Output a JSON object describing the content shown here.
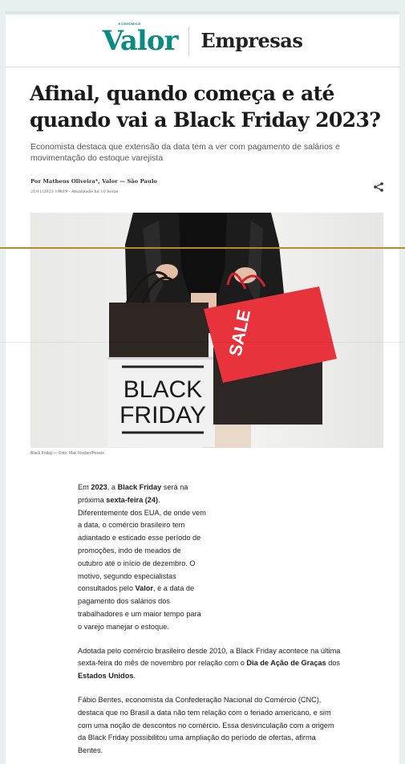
{
  "header": {
    "logo": "Valor",
    "logo_tag": "ECONÔMICO",
    "section": "Empresas"
  },
  "article": {
    "headline": "Afinal, quando começa e até quando vai a Black Friday 2023?",
    "subhead": "Economista destaca que extensão da data tem a ver com pagamento de salários e movimentação do estoque varejista",
    "byline": "Por Matheus Oliveira*, Valor — São Paulo",
    "dateline": "21/11/2023 19h19 · Atualizado há 10 horas",
    "share_icon": "share-icon",
    "photo": {
      "bag_left_text_1": "BLACK",
      "bag_left_text_2": "FRIDAY",
      "bag_right_text": "SALE"
    },
    "caption": "Black Friday — Foto: Max Fischer/Pexels",
    "p1": {
      "a": "Em ",
      "b1": "2023",
      "c": ", a ",
      "b2": "Black Friday",
      "d": " será na próxima ",
      "b3": "sexta-feira (24)",
      "e": ". Diferentemente dos EUA, de onde vem a data, o comércio brasileiro tem adiantado e esticado esse período de promoções, indo de meados de outubro até o início de dezembro. O motivo, segundo especialistas consultados pelo ",
      "b4": "Valor",
      "f": ", é a data de pagamento dos salários dos trabalhadores e um maior tempo para o varejo manejar o estoque."
    },
    "p2": {
      "a": "Adotada pelo comércio brasileiro desde 2010, a Black Friday acontece na última sexta-feira do mês de novembro por relação com o ",
      "b1": "Dia de Ação de Graças",
      "c": " dos ",
      "b2": "Estados Unidos",
      "d": "."
    },
    "p3": "Fábio Bentes, economista da Confederação Nacional do Comércio (CNC), destaca que no Brasil a data não tem relação com o feriado americano, e sim com uma noção de descontos no comércio. Essa desvinculação com a origem da Black Friday possibilitou uma ampliação do período de ofertas, afirma Bentes."
  },
  "colors": {
    "brand": "#0b8a82",
    "bag_red": "#e8323c",
    "overlay_line": "#b9892a"
  }
}
